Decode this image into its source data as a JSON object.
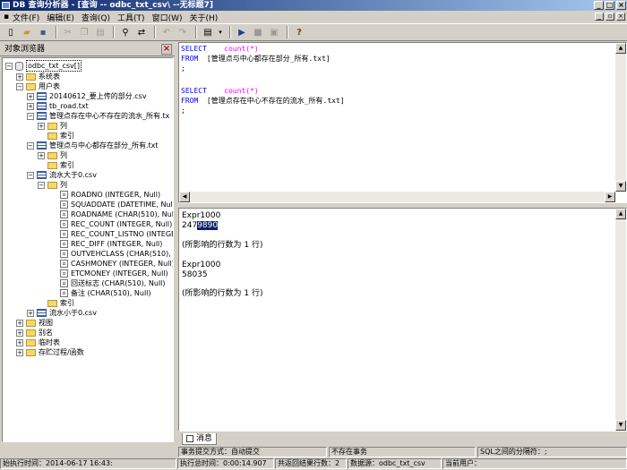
{
  "title": "DB 查询分析器 - [查询 -- odbc_txt_csv\\ --无标题7]",
  "menu": [
    "文件(F)",
    "编辑(E)",
    "查询(Q)",
    "工具(T)",
    "窗口(W)",
    "关于(H)"
  ],
  "left_panel": {
    "title": "对象浏览器",
    "tree": {
      "root": "odbc_txt_csv[]",
      "system_tables": "系统表",
      "user_tables": "用户表",
      "t1": "20140612_要上传的部分.csv",
      "t2": "tb_road.txt",
      "t3": "管理点存在中心不存在的流水_所有.tx",
      "t3_cols": "列",
      "t3_idx": "索引",
      "t4": "管理点与中心都存在部分_所有.txt",
      "t4_cols": "列",
      "t4_idx": "索引",
      "t5": "流水大于0.csv",
      "t5_cols": "列",
      "columns": [
        "ROADNO (INTEGER, Null)",
        "SQUADDATE (DATETIME, Null)",
        "ROADNAME (CHAR(510), Null)",
        "REC_COUNT (INTEGER, Null)",
        "REC_COUNT_LISTNO (INTEGE",
        "REC_DIFF (INTEGER, Null)",
        "OUTVEHCLASS (CHAR(510), Nu",
        "CASHMONEY (INTEGER, Null)",
        "ETCMONEY (INTEGER, Null)",
        "回送标志 (CHAR(510), Null)",
        "备注 (CHAR(510), Null)"
      ],
      "t5_idx": "索引",
      "t6": "流水小于0.csv",
      "views": "视图",
      "aliases": "别名",
      "temp_tables": "临时表",
      "procedures": "存贮过程/函数"
    }
  },
  "editor": {
    "q1_select": "SELECT",
    "q1_expr": "count(*)",
    "q1_from": "FROM",
    "q1_table": "[管理点与中心都存在部分_所有.txt]",
    "q1_end": ";",
    "q2_select": "SELECT",
    "q2_expr": "count(*)",
    "q2_from": "FROM",
    "q2_table": "[管理点存在中心不存在的流水_所有.txt]",
    "q2_end": ";"
  },
  "results": {
    "col1": "Expr1000",
    "val1_pre": "247",
    "val1_sel": "9890",
    "msg1": "(所影响的行数为 1 行)",
    "col2": "Expr1000",
    "val2": "58035",
    "msg2": "(所影响的行数为 1 行)"
  },
  "tab": "消息",
  "status": {
    "commit_mode": "事务提交方式：自动提交",
    "txn": "不存在事务",
    "separator": "SQL之间的分隔符：;",
    "exec_time": "始执行时间：2014-06-17 16:43:",
    "elapsed": "执行总时间：0:00:14.907",
    "rows": "共返回结果行数：2",
    "datasource": "数据源：odbc_txt_csv",
    "user": "当前用户："
  }
}
